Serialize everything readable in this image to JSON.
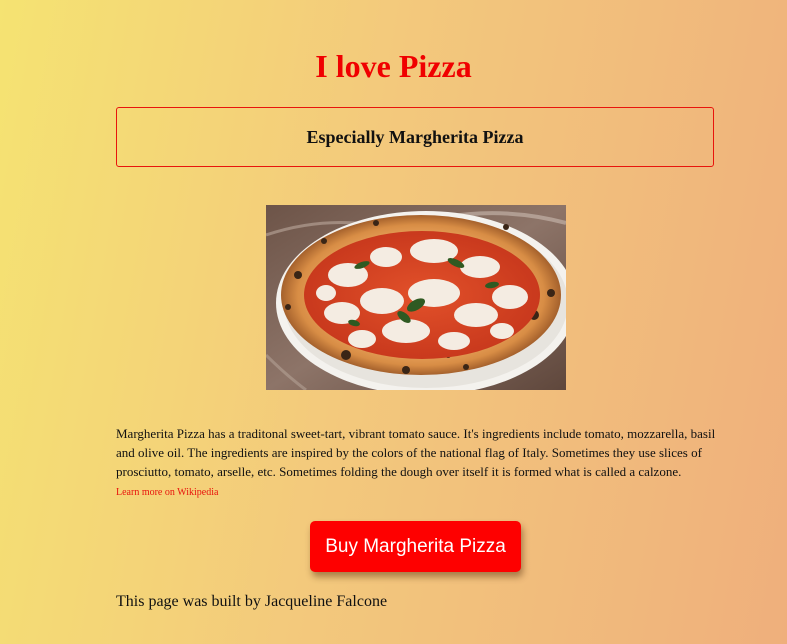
{
  "header": {
    "title": "I love Pizza",
    "subtitle": "Especially Margherita Pizza"
  },
  "main": {
    "description": "Margherita Pizza has a traditonal sweet-tart, vibrant tomato sauce. It's ingredients include tomato, mozzarella, basil and olive oil. The ingredients are inspired by the colors of the national flag of Italy. Sometimes they use slices of prosciutto, tomato, arselle, etc. Sometimes folding the dough over itself it is formed what is called a calzone.",
    "link_label": "Learn more on Wikipedia",
    "buy_label": "Buy Margherita Pizza"
  },
  "footer": {
    "text": "This page was built by Jacqueline Falcone"
  },
  "colors": {
    "accent": "#f00000",
    "button_bg": "#fe0000",
    "background_start": "#f5e372",
    "background_end": "#efaf7c"
  }
}
